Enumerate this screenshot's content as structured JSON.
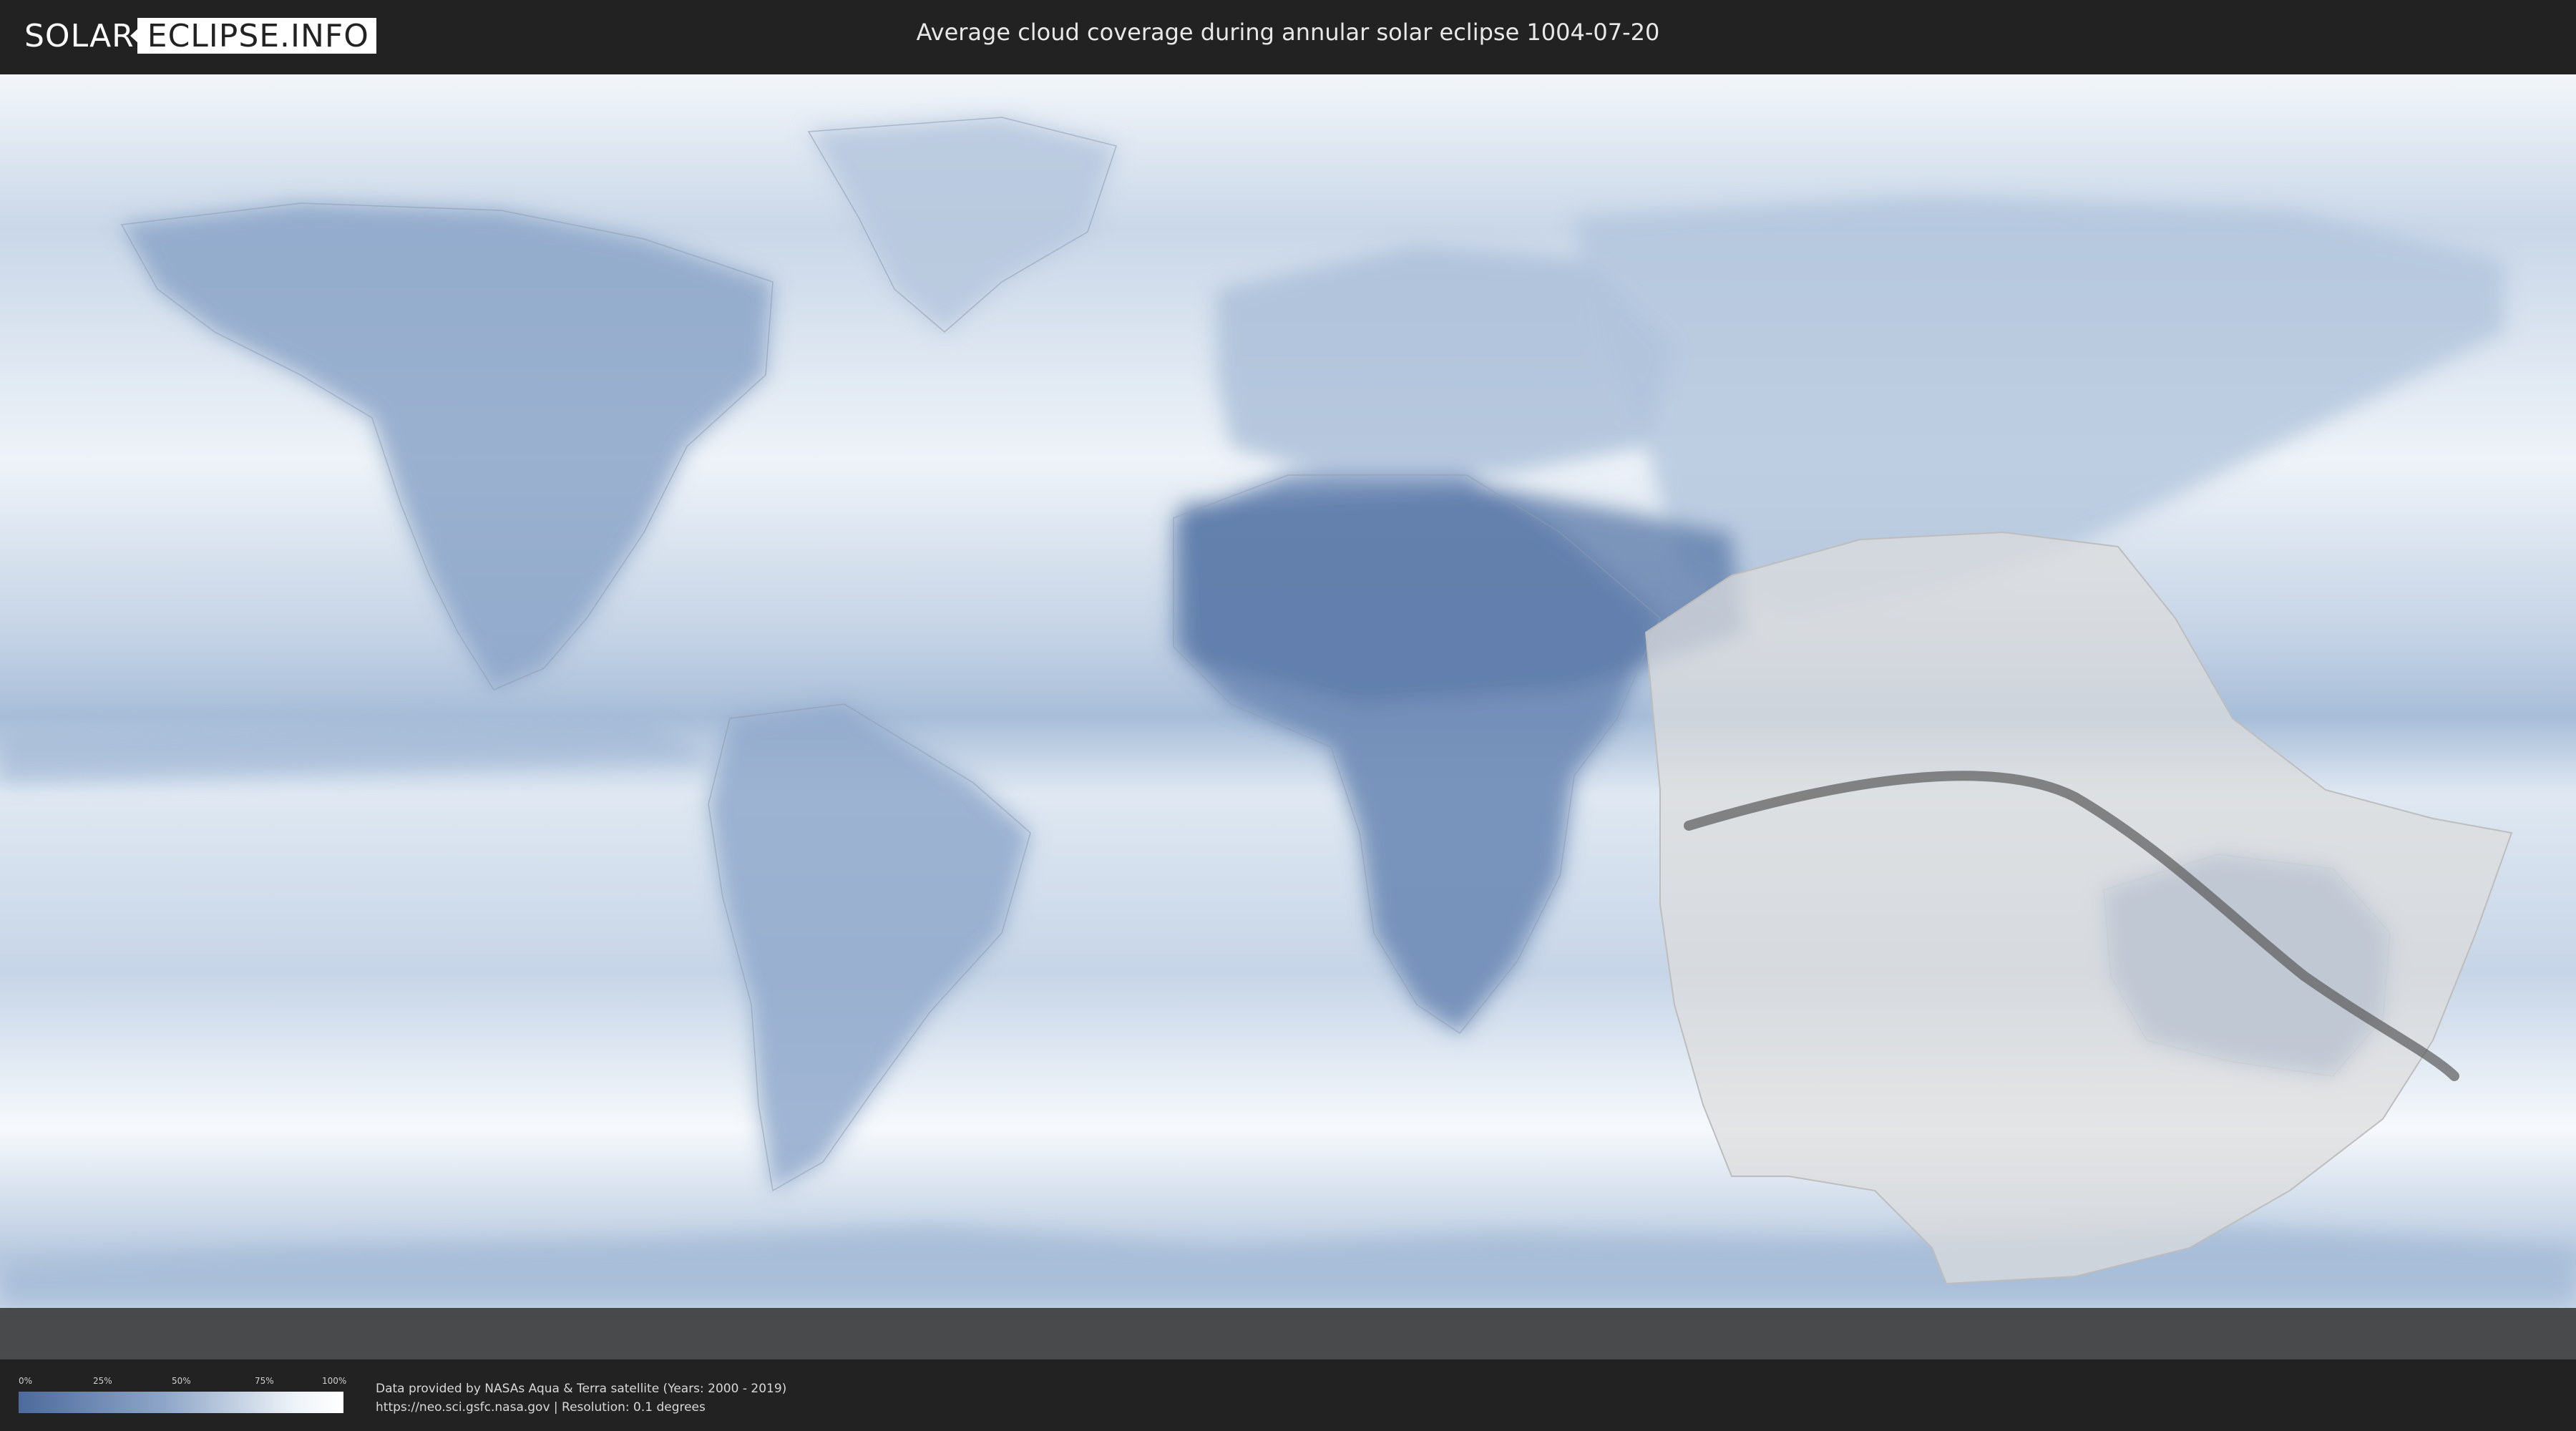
{
  "header": {
    "logo_left": "SOLAR",
    "logo_right": "ECLIPSE.INFO",
    "title": "Average cloud coverage during annular solar eclipse 1004-07-20"
  },
  "map": {
    "visible_region": "world",
    "projection": "equirectangular",
    "layer": "average cloud coverage",
    "eclipse_type": "annular",
    "eclipse_date": "1004-07-20",
    "colors": {
      "clear": "#4c6a9c",
      "cloudy": "#ffffff",
      "eclipse_visibility_overlay": "#dcdcdc",
      "central_path": "#5a5a5a",
      "polar_band": "#3a3a3a"
    }
  },
  "legend": {
    "ticks": [
      "0%",
      "25%",
      "50%",
      "75%",
      "100%"
    ]
  },
  "footer": {
    "credit_line1": "Data provided by NASAs Aqua & Terra satellite (Years: 2000 - 2019)",
    "credit_line2": "https://neo.sci.gsfc.nasa.gov | Resolution: 0.1 degrees"
  }
}
